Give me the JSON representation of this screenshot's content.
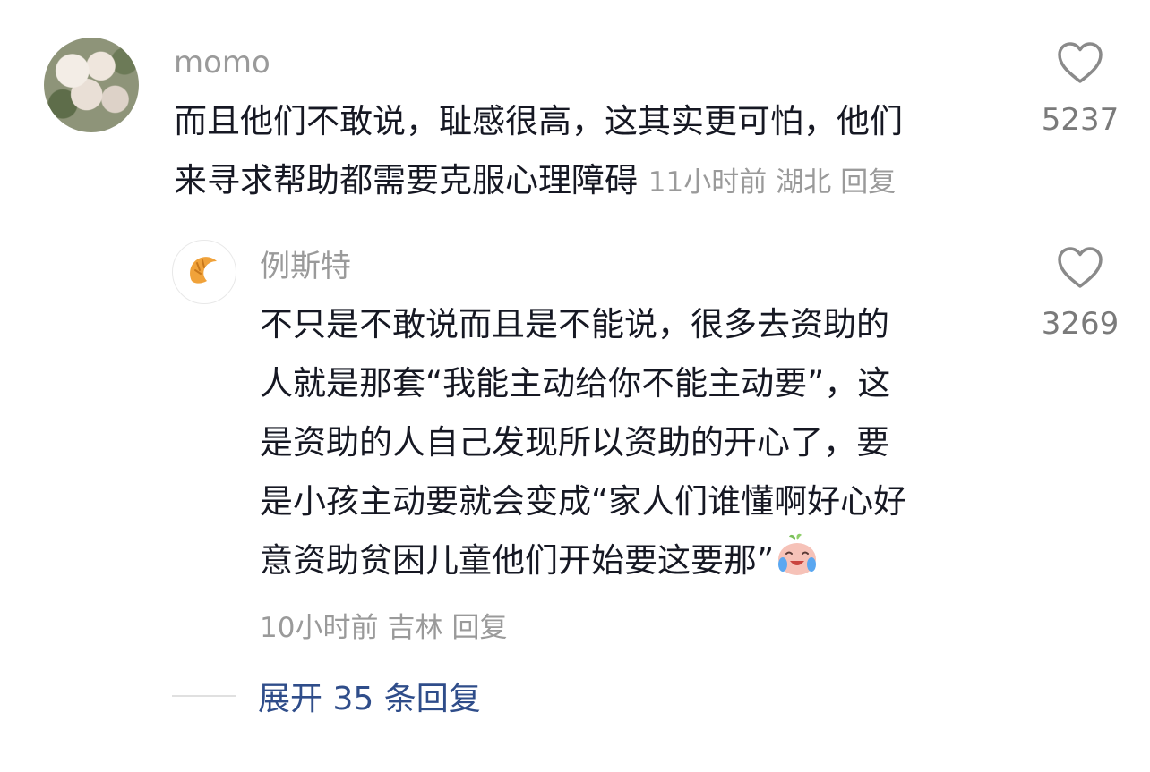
{
  "comment": {
    "username": "momo",
    "text_line1": "而且他们不敢说，耻感很高，这其实更可怕，他们",
    "text_line2": "来寻求帮助都需要克服心理障碍",
    "time": "11小时前",
    "location": "湖北",
    "reply_label": "回复",
    "likes": "5237"
  },
  "reply": {
    "username": "例斯特",
    "lines": [
      "不只是不敢说而且是不能说，很多去资助的",
      "人就是那套“我能主动给你不能主动要”，这",
      "是资助的人自己发现所以资助的开心了，要",
      "是小孩主动要就会变成“家人们谁懂啊好心好",
      "意资助贫困儿童他们开始要这要那”"
    ],
    "time": "10小时前",
    "location": "吉林",
    "reply_label": "回复",
    "likes": "3269"
  },
  "expand": {
    "label": "展开 35 条回复"
  },
  "icons": {
    "like": "heart-outline-icon",
    "reply_avatar": "croissant-icon",
    "emoji": "crying-laughing-emoji-icon"
  },
  "colors": {
    "text": "#161823",
    "muted": "#9a9a9a",
    "link": "#2f4d8a"
  }
}
